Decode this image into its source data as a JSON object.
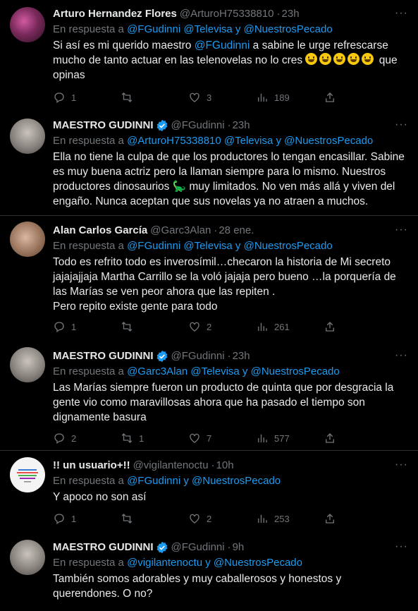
{
  "tweets": [
    {
      "name": "Arturo Hernandez Flores",
      "handle": "@ArturoH75338810",
      "dot": "·",
      "time": "23h",
      "reply_prefix": "En respuesta a",
      "reply_mentions": "@FGudinni @Televisa y @NuestrosPecado",
      "text_before": "Si así es mi querido maestro ",
      "text_mention": "@FGudinni",
      "text_after": " a sabine le urge refrescarse mucho de tanto actuar en las telenovelas no lo cres ",
      "text_tail": " que opinas",
      "emoji_count": 5,
      "verified": false,
      "stats": {
        "replies": "1",
        "retweets": "",
        "likes": "3",
        "views": "189"
      }
    },
    {
      "name": "MAESTRO GUDINNI",
      "handle": "@FGudinni",
      "dot": "·",
      "time": "23h",
      "reply_prefix": "En respuesta a",
      "reply_mentions": "@ArturoH75338810 @Televisa y @NuestrosPecado",
      "text": "Ella no tiene la culpa de que los productores lo tengan encasillar. Sabine es muy buena actriz pero la llaman siempre para lo mismo. Nuestros productores dinosaurios 🦕 muy limitados. No ven más allá y viven del engaño. Nunca aceptan que sus novelas ya no atraen a muchos.",
      "verified": true,
      "stats": null
    },
    {
      "name": "Alan Carlos García",
      "handle": "@Garc3Alan",
      "dot": "·",
      "time": "28 ene.",
      "reply_prefix": "En respuesta a",
      "reply_mentions": "@FGudinni @Televisa y @NuestrosPecado",
      "text": "Todo es refrito todo es inverosímil…checaron la historia de Mi secreto jajajajjaja Martha Carrillo se la voló jajaja pero bueno …la porquería de las Marías se ven peor ahora que las repiten .\nPero repito existe gente para todo",
      "verified": false,
      "stats": {
        "replies": "1",
        "retweets": "",
        "likes": "2",
        "views": "261"
      }
    },
    {
      "name": "MAESTRO GUDINNI",
      "handle": "@FGudinni",
      "dot": "·",
      "time": "23h",
      "reply_prefix": "En respuesta a",
      "reply_mentions": "@Garc3Alan @Televisa y @NuestrosPecado",
      "text": "Las Marías siempre fueron un producto de quinta que por desgracia la gente vio como maravillosas ahora que ha pasado el tiempo son dignamente basura",
      "verified": true,
      "stats": {
        "replies": "2",
        "retweets": "1",
        "likes": "7",
        "views": "577"
      }
    },
    {
      "name": "!! un usuario+!!",
      "handle": "@vigilantenoctu",
      "dot": "·",
      "time": "10h",
      "reply_prefix": "En respuesta a",
      "reply_mentions": "@FGudinni y @NuestrosPecado",
      "text": "Y apoco no son así",
      "verified": false,
      "stats": {
        "replies": "1",
        "retweets": "",
        "likes": "2",
        "views": "253"
      }
    },
    {
      "name": "MAESTRO GUDINNI",
      "handle": "@FGudinni",
      "dot": "·",
      "time": "9h",
      "reply_prefix": "En respuesta a",
      "reply_mentions": "@vigilantenoctu y @NuestrosPecado",
      "text": "También somos adorables y muy caballerosos y honestos y querendones. O no?",
      "verified": true,
      "stats": null
    }
  ],
  "more_label": "···",
  "colors": {
    "background": "#000000",
    "text": "#e7e9ea",
    "muted": "#71767b",
    "link": "#1d9bf0",
    "verified": "#1d9bf0",
    "divider": "#2f3336"
  }
}
